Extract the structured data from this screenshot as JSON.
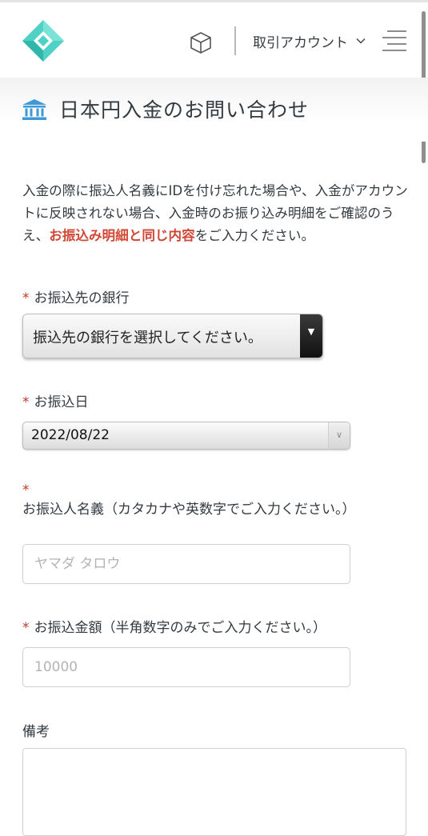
{
  "header": {
    "account_label": "取引アカウント",
    "logo_icon": "diamond-logo-icon",
    "cube_icon": "cube-icon",
    "menu_icon": "hamburger-menu-icon"
  },
  "page": {
    "title": "日本円入金のお問い合わせ",
    "title_icon": "bank-icon",
    "intro_text_1": "入金の際に振込人名義にIDを付け忘れた場合や、入金がアカウントに反映されない場合、入金時のお振り込み明細をご確認のうえ、",
    "intro_emphasis": "お振込み明細と同じ内容",
    "intro_text_2": "をご入力ください。"
  },
  "form": {
    "required_mark": "*",
    "bank": {
      "label": "お振込先の銀行",
      "selected": "振込先の銀行を選択してください。"
    },
    "date": {
      "label": "お振込日",
      "selected": "2022/08/22"
    },
    "name": {
      "label": "お振込人名義（カタカナや英数字でご入力ください。）",
      "placeholder": "ヤマダ タロウ"
    },
    "amount": {
      "label": "お振込金額（半角数字のみでご入力ください。）",
      "placeholder": "10000"
    },
    "remarks": {
      "label": "備考"
    }
  },
  "colors": {
    "logo_teal": "#4fd1c5",
    "bank_icon_blue": "#3e9ad6",
    "emphasis_red": "#d14836",
    "required_red": "#c0392b"
  }
}
